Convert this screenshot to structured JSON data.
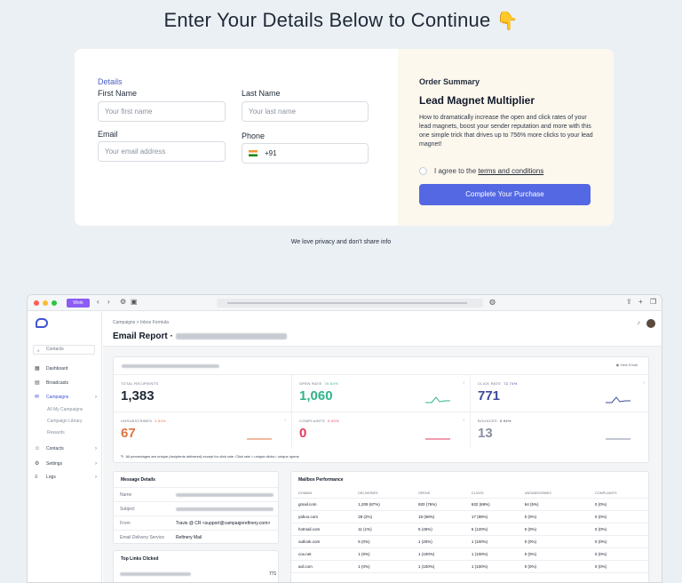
{
  "heading": {
    "text": "Enter Your Details Below to Continue",
    "emoji": "👇"
  },
  "form": {
    "section_title": "Details",
    "first_name": {
      "label": "First Name",
      "placeholder": "Your first name"
    },
    "last_name": {
      "label": "Last Name",
      "placeholder": "Your last name"
    },
    "email": {
      "label": "Email",
      "placeholder": "Your email address"
    },
    "phone": {
      "label": "Phone",
      "value": "+91"
    }
  },
  "summary": {
    "heading": "Order Summary",
    "product": "Lead Magnet Multiplier",
    "description": "How to dramatically increase the open and click rates of your lead magnets, boost your sender reputation and more with this one simple trick that drives up to 756% more clicks to your lead magnet!",
    "agree_prefix": "I agree to the",
    "agree_link": "terms and conditions",
    "button": "Complete Your Purchase"
  },
  "privacy": "We love privacy and don't share info",
  "app": {
    "browser": {
      "workspace": "Work"
    },
    "sidebar": {
      "search_placeholder": "Contacts",
      "items": [
        {
          "label": "Dashboard"
        },
        {
          "label": "Broadcasts"
        },
        {
          "label": "Campaigns"
        },
        {
          "label": "All My Campaigns"
        },
        {
          "label": "Campaign Library"
        },
        {
          "label": "Rewards"
        },
        {
          "label": "Contacts"
        },
        {
          "label": "Settings"
        },
        {
          "label": "Logs"
        }
      ]
    },
    "breadcrumb": "Campaigns > Inbox Formula",
    "title": "Email Report ·",
    "view_email": "View Email",
    "stats": [
      {
        "label": "TOTAL RECIPIENTS",
        "rate": "",
        "value": "1,383",
        "color": "#1f2937"
      },
      {
        "label": "OPEN RATE",
        "rate": "76.64%",
        "value": "1,060",
        "color": "#2fb48a"
      },
      {
        "label": "CLICK RATE",
        "rate": "72.74%",
        "value": "771",
        "color": "#3b4a9c"
      },
      {
        "label": "UNSUBSCRIBES",
        "rate": "4.84%",
        "value": "67",
        "color": "#e07440"
      },
      {
        "label": "COMPLAINTS",
        "rate": "0.00%",
        "value": "0",
        "color": "#e23b5e"
      },
      {
        "label": "BOUNCES",
        "rate": "0.94%",
        "value": "13",
        "color": "#8a8fa3"
      }
    ],
    "footnote": "All percentages are unique (recipients delivered) except for click rate. Click rate = unique clicks / unique opens",
    "message_details": {
      "title": "Message Details",
      "rows": [
        {
          "key": "Name",
          "value": ""
        },
        {
          "key": "Subject",
          "value": ""
        },
        {
          "key": "From",
          "value": "Travis @ CR <support@campaignrefinery.com>"
        },
        {
          "key": "Email Delivery Service",
          "value": "Refinery Mail"
        }
      ]
    },
    "top_links": {
      "title": "Top Links Clicked",
      "count": "771"
    },
    "mailbox": {
      "title": "Mailbox Performance",
      "columns": [
        "DOMAIN",
        "DELIVERIES",
        "OPENS",
        "CLICKS",
        "UNSUBSCRIBES",
        "COMPLAINTS"
      ],
      "rows": [
        [
          "gmail.com",
          "1,209 (87%)",
          "920 (76%)",
          "632 (69%)",
          "64 (5%)",
          "0 (0%)"
        ],
        [
          "yahoo.com",
          "28 (2%)",
          "19 (68%)",
          "17 (89%)",
          "0 (0%)",
          "0 (0%)"
        ],
        [
          "hotmail.com",
          "11 (1%)",
          "5 (45%)",
          "6 (120%)",
          "0 (0%)",
          "0 (0%)"
        ],
        [
          "outlook.com",
          "5 (0%)",
          "1 (20%)",
          "1 (100%)",
          "0 (0%)",
          "0 (0%)"
        ],
        [
          "cox.net",
          "1 (0%)",
          "1 (100%)",
          "1 (100%)",
          "0 (0%)",
          "0 (0%)"
        ],
        [
          "aol.com",
          "1 (0%)",
          "1 (100%)",
          "1 (100%)",
          "0 (0%)",
          "0 (0%)"
        ]
      ]
    }
  }
}
